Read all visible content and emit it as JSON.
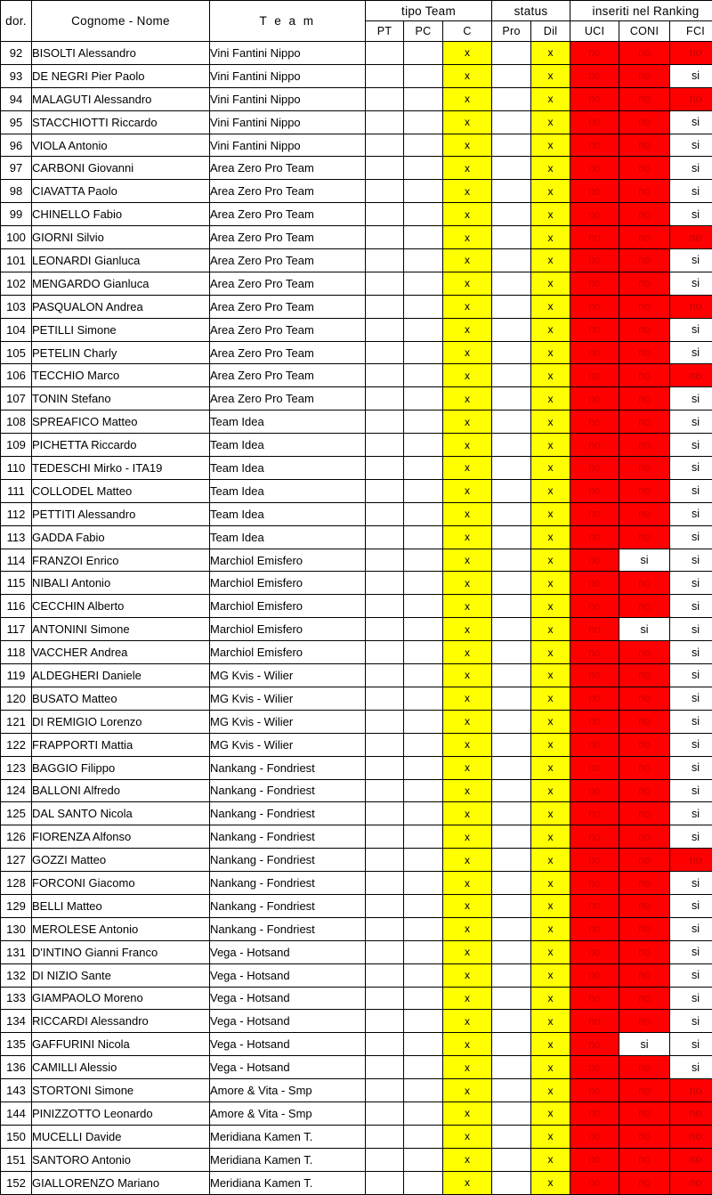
{
  "table": {
    "group_headers": [
      {
        "label": "dor.",
        "span": 1,
        "kind": "single"
      },
      {
        "label": "Cognome - Nome",
        "span": 1,
        "kind": "single"
      },
      {
        "label": "T e a m",
        "span": 1,
        "kind": "single"
      },
      {
        "label": "tipo Team",
        "span": 3,
        "kind": "group"
      },
      {
        "label": "status",
        "span": 2,
        "kind": "group"
      },
      {
        "label": "inseriti nel Ranking",
        "span": 3,
        "kind": "group"
      }
    ],
    "sub_headers": [
      "PT",
      "PC",
      "C",
      "Pro",
      "Dil",
      "UCI",
      "CONI",
      "FCI"
    ],
    "columns": [
      "dor.",
      "Cognome - Nome",
      "T e a m",
      "PT",
      "PC",
      "C",
      "Pro",
      "Dil",
      "UCI",
      "CONI",
      "FCI"
    ],
    "rows": [
      {
        "dor": "92",
        "name": "BISOLTI Alessandro",
        "team": "Vini Fantini Nippo",
        "PT": "",
        "PC": "",
        "C": "x",
        "Pro": "",
        "Dil": "x",
        "UCI": "no",
        "CONI": "no",
        "FCI": "no"
      },
      {
        "dor": "93",
        "name": "DE NEGRI Pier Paolo",
        "team": "Vini Fantini Nippo",
        "PT": "",
        "PC": "",
        "C": "x",
        "Pro": "",
        "Dil": "x",
        "UCI": "no",
        "CONI": "no",
        "FCI": "si"
      },
      {
        "dor": "94",
        "name": "MALAGUTI Alessandro",
        "team": "Vini Fantini Nippo",
        "PT": "",
        "PC": "",
        "C": "x",
        "Pro": "",
        "Dil": "x",
        "UCI": "no",
        "CONI": "no",
        "FCI": "no"
      },
      {
        "dor": "95",
        "name": "STACCHIOTTI Riccardo",
        "team": "Vini Fantini Nippo",
        "PT": "",
        "PC": "",
        "C": "x",
        "Pro": "",
        "Dil": "x",
        "UCI": "no",
        "CONI": "no",
        "FCI": "si"
      },
      {
        "dor": "96",
        "name": "VIOLA Antonio",
        "team": "Vini Fantini Nippo",
        "PT": "",
        "PC": "",
        "C": "x",
        "Pro": "",
        "Dil": "x",
        "UCI": "no",
        "CONI": "no",
        "FCI": "si"
      },
      {
        "dor": "97",
        "name": "CARBONI Giovanni",
        "team": "Area Zero Pro Team",
        "PT": "",
        "PC": "",
        "C": "x",
        "Pro": "",
        "Dil": "x",
        "UCI": "no",
        "CONI": "no",
        "FCI": "si"
      },
      {
        "dor": "98",
        "name": "CIAVATTA Paolo",
        "team": "Area Zero Pro Team",
        "PT": "",
        "PC": "",
        "C": "x",
        "Pro": "",
        "Dil": "x",
        "UCI": "no",
        "CONI": "no",
        "FCI": "si"
      },
      {
        "dor": "99",
        "name": "CHINELLO Fabio",
        "team": "Area Zero Pro Team",
        "PT": "",
        "PC": "",
        "C": "x",
        "Pro": "",
        "Dil": "x",
        "UCI": "no",
        "CONI": "no",
        "FCI": "si"
      },
      {
        "dor": "100",
        "name": "GIORNI Silvio",
        "team": "Area Zero Pro Team",
        "PT": "",
        "PC": "",
        "C": "x",
        "Pro": "",
        "Dil": "x",
        "UCI": "no",
        "CONI": "no",
        "FCI": "no"
      },
      {
        "dor": "101",
        "name": "LEONARDI Gianluca",
        "team": "Area Zero Pro Team",
        "PT": "",
        "PC": "",
        "C": "x",
        "Pro": "",
        "Dil": "x",
        "UCI": "no",
        "CONI": "no",
        "FCI": "si"
      },
      {
        "dor": "102",
        "name": "MENGARDO Gianluca",
        "team": "Area Zero Pro Team",
        "PT": "",
        "PC": "",
        "C": "x",
        "Pro": "",
        "Dil": "x",
        "UCI": "no",
        "CONI": "no",
        "FCI": "si"
      },
      {
        "dor": "103",
        "name": "PASQUALON Andrea",
        "team": "Area Zero Pro Team",
        "PT": "",
        "PC": "",
        "C": "x",
        "Pro": "",
        "Dil": "x",
        "UCI": "no",
        "CONI": "no",
        "FCI": "no"
      },
      {
        "dor": "104",
        "name": "PETILLI Simone",
        "team": "Area Zero Pro Team",
        "PT": "",
        "PC": "",
        "C": "x",
        "Pro": "",
        "Dil": "x",
        "UCI": "no",
        "CONI": "no",
        "FCI": "si"
      },
      {
        "dor": "105",
        "name": "PETELIN Charly",
        "team": "Area Zero Pro Team",
        "PT": "",
        "PC": "",
        "C": "x",
        "Pro": "",
        "Dil": "x",
        "UCI": "no",
        "CONI": "no",
        "FCI": "si"
      },
      {
        "dor": "106",
        "name": "TECCHIO Marco",
        "team": "Area Zero Pro Team",
        "PT": "",
        "PC": "",
        "C": "x",
        "Pro": "",
        "Dil": "x",
        "UCI": "no",
        "CONI": "no",
        "FCI": "no"
      },
      {
        "dor": "107",
        "name": "TONIN Stefano",
        "team": "Area Zero Pro Team",
        "PT": "",
        "PC": "",
        "C": "x",
        "Pro": "",
        "Dil": "x",
        "UCI": "no",
        "CONI": "no",
        "FCI": "si"
      },
      {
        "dor": "108",
        "name": "SPREAFICO Matteo",
        "team": "Team Idea",
        "PT": "",
        "PC": "",
        "C": "x",
        "Pro": "",
        "Dil": "x",
        "UCI": "no",
        "CONI": "no",
        "FCI": "si"
      },
      {
        "dor": "109",
        "name": "PICHETTA Riccardo",
        "team": "Team Idea",
        "PT": "",
        "PC": "",
        "C": "x",
        "Pro": "",
        "Dil": "x",
        "UCI": "no",
        "CONI": "no",
        "FCI": "si"
      },
      {
        "dor": "110",
        "name": "TEDESCHI Mirko - ITA19",
        "team": "Team Idea",
        "PT": "",
        "PC": "",
        "C": "x",
        "Pro": "",
        "Dil": "x",
        "UCI": "no",
        "CONI": "no",
        "FCI": "si"
      },
      {
        "dor": "111",
        "name": "COLLODEL Matteo",
        "team": "Team Idea",
        "PT": "",
        "PC": "",
        "C": "x",
        "Pro": "",
        "Dil": "x",
        "UCI": "no",
        "CONI": "no",
        "FCI": "si"
      },
      {
        "dor": "112",
        "name": "PETTITI Alessandro",
        "team": "Team Idea",
        "PT": "",
        "PC": "",
        "C": "x",
        "Pro": "",
        "Dil": "x",
        "UCI": "no",
        "CONI": "no",
        "FCI": "si"
      },
      {
        "dor": "113",
        "name": "GADDA Fabio",
        "team": "Team Idea",
        "PT": "",
        "PC": "",
        "C": "x",
        "Pro": "",
        "Dil": "x",
        "UCI": "no",
        "CONI": "no",
        "FCI": "si"
      },
      {
        "dor": "114",
        "name": "FRANZOI Enrico",
        "team": "Marchiol Emisfero",
        "PT": "",
        "PC": "",
        "C": "x",
        "Pro": "",
        "Dil": "x",
        "UCI": "no",
        "CONI": "si",
        "FCI": "si"
      },
      {
        "dor": "115",
        "name": "NIBALI Antonio",
        "team": "Marchiol Emisfero",
        "PT": "",
        "PC": "",
        "C": "x",
        "Pro": "",
        "Dil": "x",
        "UCI": "no",
        "CONI": "no",
        "FCI": "si"
      },
      {
        "dor": "116",
        "name": "CECCHIN Alberto",
        "team": "Marchiol Emisfero",
        "PT": "",
        "PC": "",
        "C": "x",
        "Pro": "",
        "Dil": "x",
        "UCI": "no",
        "CONI": "no",
        "FCI": "si"
      },
      {
        "dor": "117",
        "name": "ANTONINI Simone",
        "team": "Marchiol Emisfero",
        "PT": "",
        "PC": "",
        "C": "x",
        "Pro": "",
        "Dil": "x",
        "UCI": "no",
        "CONI": "si",
        "FCI": "si"
      },
      {
        "dor": "118",
        "name": "VACCHER Andrea",
        "team": "Marchiol Emisfero",
        "PT": "",
        "PC": "",
        "C": "x",
        "Pro": "",
        "Dil": "x",
        "UCI": "no",
        "CONI": "no",
        "FCI": "si"
      },
      {
        "dor": "119",
        "name": "ALDEGHERI Daniele",
        "team": "MG Kvis - Wilier",
        "PT": "",
        "PC": "",
        "C": "x",
        "Pro": "",
        "Dil": "x",
        "UCI": "no",
        "CONI": "no",
        "FCI": "si"
      },
      {
        "dor": "120",
        "name": "BUSATO Matteo",
        "team": "MG Kvis - Wilier",
        "PT": "",
        "PC": "",
        "C": "x",
        "Pro": "",
        "Dil": "x",
        "UCI": "no",
        "CONI": "no",
        "FCI": "si"
      },
      {
        "dor": "121",
        "name": "DI REMIGIO Lorenzo",
        "team": "MG Kvis - Wilier",
        "PT": "",
        "PC": "",
        "C": "x",
        "Pro": "",
        "Dil": "x",
        "UCI": "no",
        "CONI": "no",
        "FCI": "si"
      },
      {
        "dor": "122",
        "name": "FRAPPORTI Mattia",
        "team": "MG Kvis - Wilier",
        "PT": "",
        "PC": "",
        "C": "x",
        "Pro": "",
        "Dil": "x",
        "UCI": "no",
        "CONI": "no",
        "FCI": "si"
      },
      {
        "dor": "123",
        "name": "BAGGIO Filippo",
        "team": "Nankang - Fondriest",
        "PT": "",
        "PC": "",
        "C": "x",
        "Pro": "",
        "Dil": "x",
        "UCI": "no",
        "CONI": "no",
        "FCI": "si"
      },
      {
        "dor": "124",
        "name": "BALLONI Alfredo",
        "team": "Nankang - Fondriest",
        "PT": "",
        "PC": "",
        "C": "x",
        "Pro": "",
        "Dil": "x",
        "UCI": "no",
        "CONI": "no",
        "FCI": "si"
      },
      {
        "dor": "125",
        "name": "DAL SANTO Nicola",
        "team": "Nankang - Fondriest",
        "PT": "",
        "PC": "",
        "C": "x",
        "Pro": "",
        "Dil": "x",
        "UCI": "no",
        "CONI": "no",
        "FCI": "si"
      },
      {
        "dor": "126",
        "name": "FIORENZA Alfonso",
        "team": "Nankang - Fondriest",
        "PT": "",
        "PC": "",
        "C": "x",
        "Pro": "",
        "Dil": "x",
        "UCI": "no",
        "CONI": "no",
        "FCI": "si"
      },
      {
        "dor": "127",
        "name": "GOZZI Matteo",
        "team": "Nankang - Fondriest",
        "PT": "",
        "PC": "",
        "C": "x",
        "Pro": "",
        "Dil": "x",
        "UCI": "no",
        "CONI": "no",
        "FCI": "no"
      },
      {
        "dor": "128",
        "name": "FORCONI Giacomo",
        "team": "Nankang - Fondriest",
        "PT": "",
        "PC": "",
        "C": "x",
        "Pro": "",
        "Dil": "x",
        "UCI": "no",
        "CONI": "no",
        "FCI": "si"
      },
      {
        "dor": "129",
        "name": "BELLI Matteo",
        "team": "Nankang - Fondriest",
        "PT": "",
        "PC": "",
        "C": "x",
        "Pro": "",
        "Dil": "x",
        "UCI": "no",
        "CONI": "no",
        "FCI": "si"
      },
      {
        "dor": "130",
        "name": "MEROLESE Antonio",
        "team": "Nankang - Fondriest",
        "PT": "",
        "PC": "",
        "C": "x",
        "Pro": "",
        "Dil": "x",
        "UCI": "no",
        "CONI": "no",
        "FCI": "si"
      },
      {
        "dor": "131",
        "name": "D'INTINO Gianni Franco",
        "team": "Vega - Hotsand",
        "PT": "",
        "PC": "",
        "C": "x",
        "Pro": "",
        "Dil": "x",
        "UCI": "no",
        "CONI": "no",
        "FCI": "si"
      },
      {
        "dor": "132",
        "name": "DI NIZIO Sante",
        "team": "Vega - Hotsand",
        "PT": "",
        "PC": "",
        "C": "x",
        "Pro": "",
        "Dil": "x",
        "UCI": "no",
        "CONI": "no",
        "FCI": "si"
      },
      {
        "dor": "133",
        "name": "GIAMPAOLO Moreno",
        "team": "Vega - Hotsand",
        "PT": "",
        "PC": "",
        "C": "x",
        "Pro": "",
        "Dil": "x",
        "UCI": "no",
        "CONI": "no",
        "FCI": "si"
      },
      {
        "dor": "134",
        "name": "RICCARDI Alessandro",
        "team": "Vega - Hotsand",
        "PT": "",
        "PC": "",
        "C": "x",
        "Pro": "",
        "Dil": "x",
        "UCI": "no",
        "CONI": "no",
        "FCI": "si"
      },
      {
        "dor": "135",
        "name": "GAFFURINI Nicola",
        "team": "Vega - Hotsand",
        "PT": "",
        "PC": "",
        "C": "x",
        "Pro": "",
        "Dil": "x",
        "UCI": "no",
        "CONI": "si",
        "FCI": "si"
      },
      {
        "dor": "136",
        "name": "CAMILLI Alessio",
        "team": "Vega - Hotsand",
        "PT": "",
        "PC": "",
        "C": "x",
        "Pro": "",
        "Dil": "x",
        "UCI": "no",
        "CONI": "no",
        "FCI": "si"
      },
      {
        "dor": "143",
        "name": "STORTONI Simone",
        "team": "Amore & Vita - Smp",
        "PT": "",
        "PC": "",
        "C": "x",
        "Pro": "",
        "Dil": "x",
        "UCI": "no",
        "CONI": "no",
        "FCI": "no"
      },
      {
        "dor": "144",
        "name": "PINIZZOTTO Leonardo",
        "team": "Amore & Vita - Smp",
        "PT": "",
        "PC": "",
        "C": "x",
        "Pro": "",
        "Dil": "x",
        "UCI": "no",
        "CONI": "no",
        "FCI": "no"
      },
      {
        "dor": "150",
        "name": "MUCELLI Davide",
        "team": "Meridiana Kamen T.",
        "PT": "",
        "PC": "",
        "C": "x",
        "Pro": "",
        "Dil": "x",
        "UCI": "no",
        "CONI": "no",
        "FCI": "no"
      },
      {
        "dor": "151",
        "name": "SANTORO Antonio",
        "team": "Meridiana Kamen T.",
        "PT": "",
        "PC": "",
        "C": "x",
        "Pro": "",
        "Dil": "x",
        "UCI": "no",
        "CONI": "no",
        "FCI": "no"
      },
      {
        "dor": "152",
        "name": "GIALLORENZO Mariano",
        "team": "Meridiana Kamen T.",
        "PT": "",
        "PC": "",
        "C": "x",
        "Pro": "",
        "Dil": "x",
        "UCI": "no",
        "CONI": "no",
        "FCI": "no"
      }
    ]
  },
  "colors": {
    "highlight_yellow": "#ffff00",
    "highlight_red": "#ff0000",
    "text_on_red": "#cc0000",
    "border": "#000000",
    "background": "#ffffff"
  }
}
